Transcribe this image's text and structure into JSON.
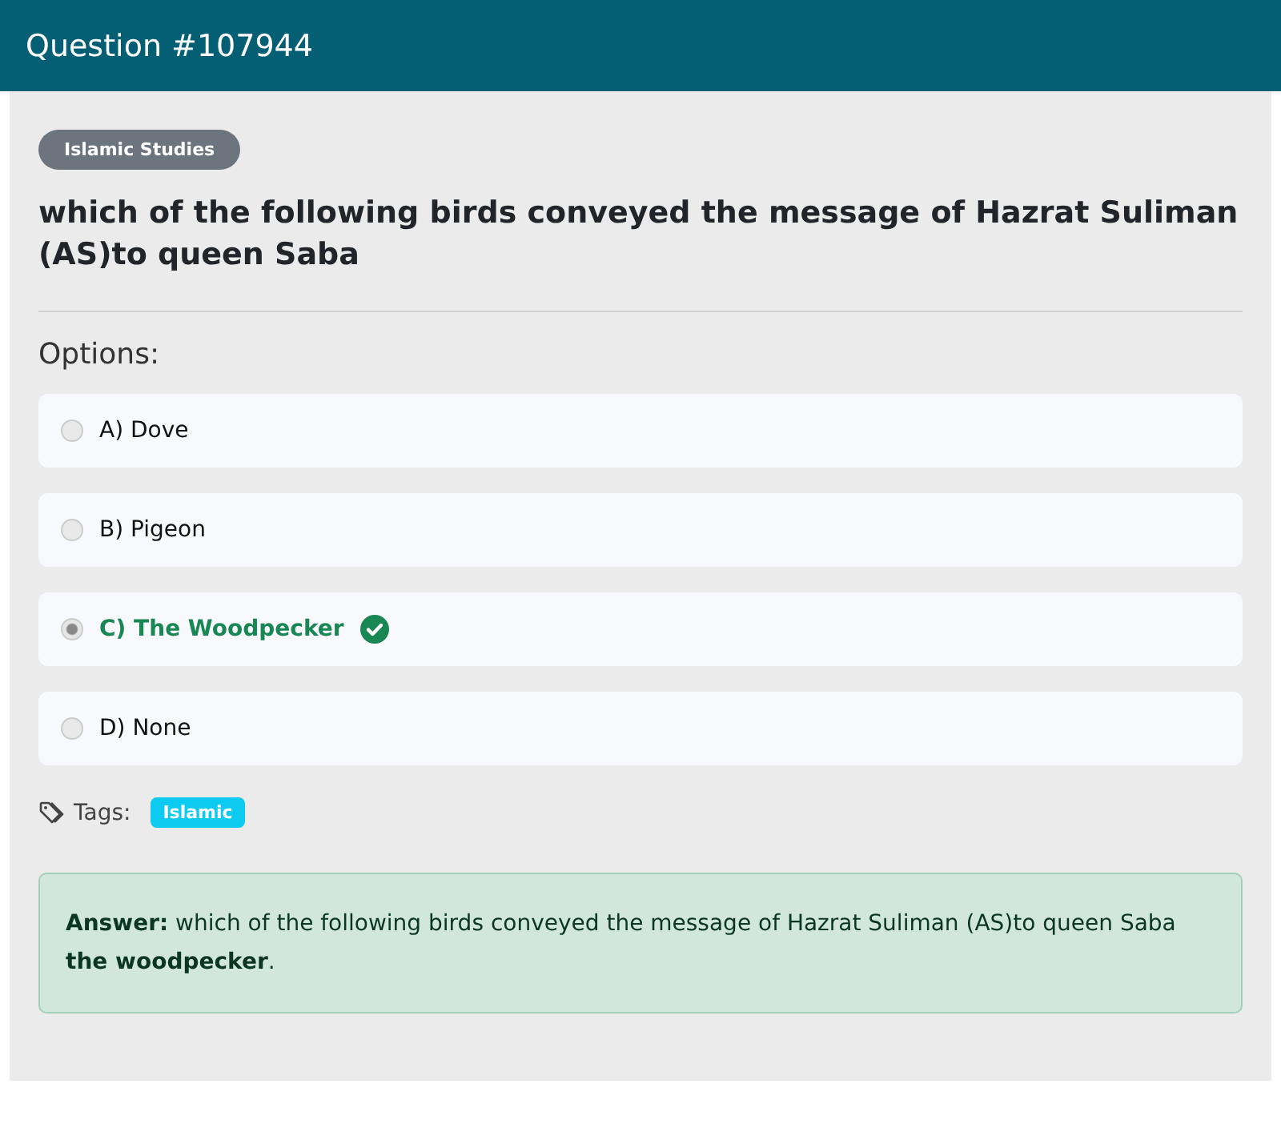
{
  "header": {
    "title": "Question #107944"
  },
  "category": "Islamic Studies",
  "question": "which of the following birds conveyed the message of Hazrat Suliman (AS)to queen Saba",
  "options_label": "Options:",
  "options": [
    {
      "text": "A) Dove",
      "selected": false,
      "correct": false
    },
    {
      "text": "B) Pigeon",
      "selected": false,
      "correct": false
    },
    {
      "text": "C) The Woodpecker",
      "selected": true,
      "correct": true
    },
    {
      "text": "D) None",
      "selected": false,
      "correct": false
    }
  ],
  "tags_label": "Tags:",
  "tags": [
    "Islamic"
  ],
  "answer": "**Answer:** which of the following birds conveyed the message of Hazrat Suliman (AS)to queen Saba **the woodpecker**."
}
